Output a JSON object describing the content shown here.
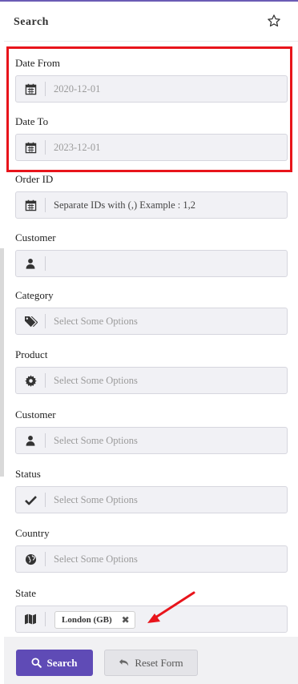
{
  "header": {
    "title": "Search",
    "star_icon": "star-outline-icon"
  },
  "fields": [
    {
      "label": "Date From",
      "icon": "calendar-icon",
      "value": "2020-12-01"
    },
    {
      "label": "Date To",
      "icon": "calendar-icon",
      "value": "2023-12-01"
    },
    {
      "label": "Order ID",
      "icon": "calendar-icon",
      "placeholder": "Separate IDs with (,) Example : 1,2"
    },
    {
      "label": "Customer",
      "icon": "user-icon",
      "value": ""
    },
    {
      "label": "Category",
      "icon": "tags-icon",
      "placeholder": "Select Some Options"
    },
    {
      "label": "Product",
      "icon": "gear-icon",
      "placeholder": "Select Some Options"
    },
    {
      "label": "Customer",
      "icon": "user-icon",
      "placeholder": "Select Some Options"
    },
    {
      "label": "Status",
      "icon": "check-icon",
      "placeholder": "Select Some Options"
    },
    {
      "label": "Country",
      "icon": "globe-icon",
      "placeholder": "Select Some Options"
    },
    {
      "label": "State",
      "icon": "map-icon",
      "selected": [
        "London (GB)"
      ]
    }
  ],
  "footer": {
    "search_label": "Search",
    "reset_label": "Reset Form"
  },
  "colors": {
    "accent": "#5f4bb6",
    "highlight": "#e8141b",
    "input_bg": "#f1f1f5"
  }
}
